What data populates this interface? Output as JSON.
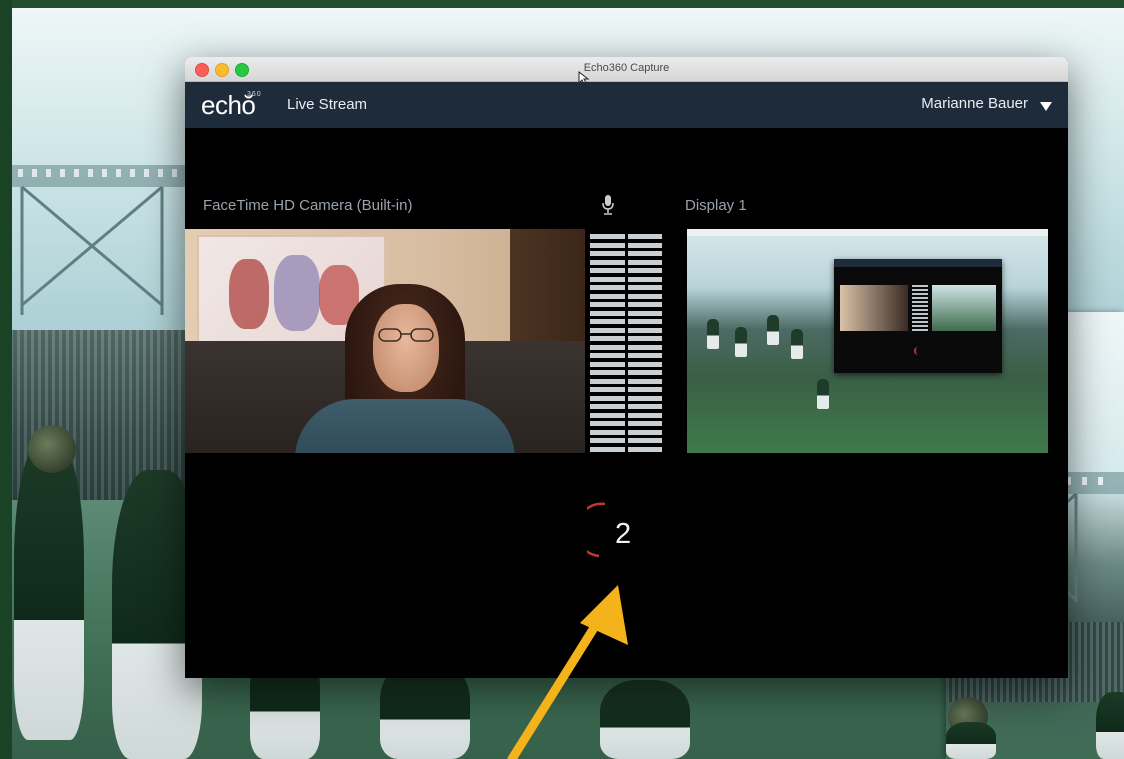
{
  "window": {
    "title": "Echo360 Capture"
  },
  "app": {
    "logo": "echŏ",
    "logo_mark": "360",
    "section": "Live Stream",
    "user_name": "Marianne Bauer"
  },
  "sources": {
    "camera_label": "FaceTime HD Camera (Built-in)",
    "display_label": "Display 1"
  },
  "audio_meter": {
    "rows": 26,
    "columns": 2
  },
  "countdown": {
    "value": "2"
  },
  "colors": {
    "appbar": "#1e2b3a",
    "countdown_arc": "#c0392b",
    "arrow": "#f5b31b",
    "window_bg": "#000000"
  },
  "icons": [
    "microphone-icon",
    "chevron-down-icon",
    "cursor-icon"
  ]
}
